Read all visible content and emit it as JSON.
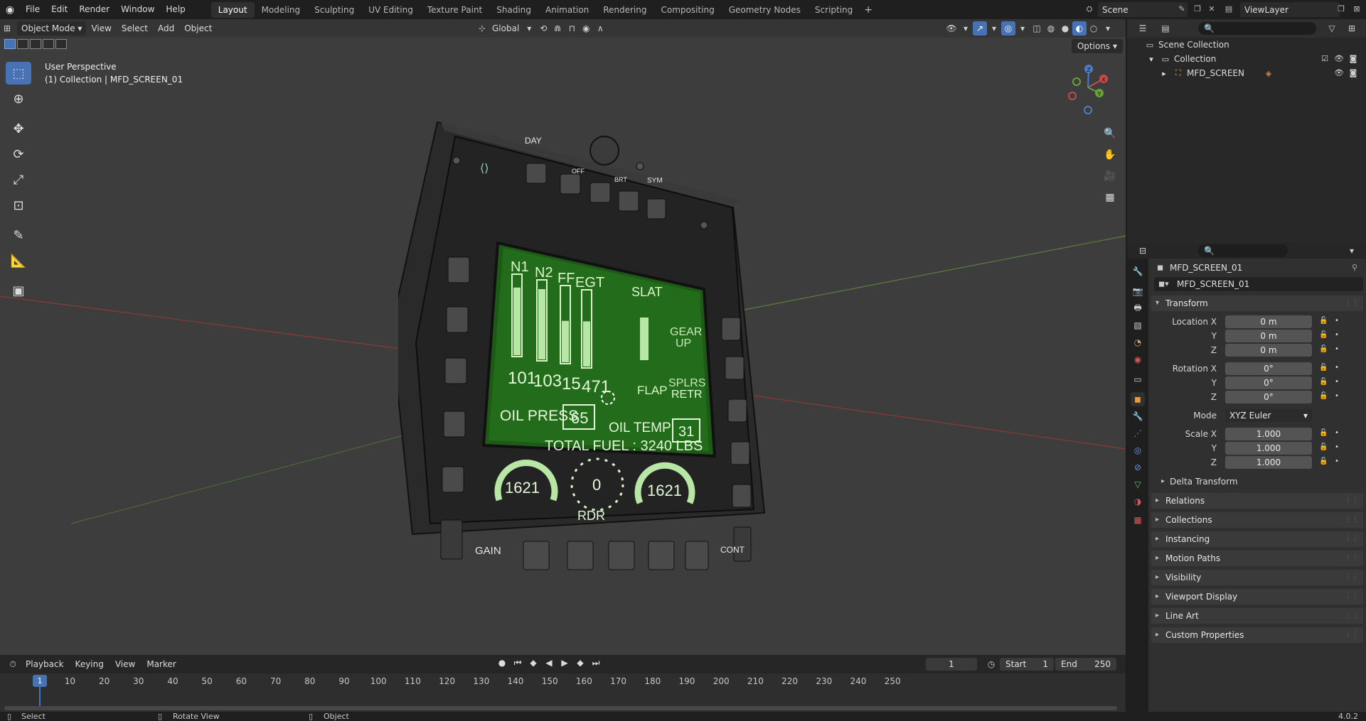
{
  "topbar": {
    "menus": [
      "File",
      "Edit",
      "Render",
      "Window",
      "Help"
    ],
    "workspaces": [
      "Layout",
      "Modeling",
      "Sculpting",
      "UV Editing",
      "Texture Paint",
      "Shading",
      "Animation",
      "Rendering",
      "Compositing",
      "Geometry Nodes",
      "Scripting"
    ],
    "active_workspace": "Layout",
    "scene": "Scene",
    "view_layer": "ViewLayer"
  },
  "viewport": {
    "mode": "Object Mode",
    "menus": [
      "View",
      "Select",
      "Add",
      "Object"
    ],
    "transform_orientation": "Global",
    "options": "Options",
    "perspective_label": "User Perspective",
    "collection_label": "(1) Collection | MFD_SCREEN_01",
    "gizmo": {
      "x": "X",
      "y": "Y",
      "z": "Z"
    }
  },
  "mfd": {
    "top_labels": {
      "day": "DAY",
      "off": "OFF",
      "brt": "BRT",
      "sym": "SYM"
    },
    "engine_labels": [
      "N1",
      "N2",
      "FF",
      "EGT"
    ],
    "engine_values": [
      "101",
      "103",
      "15",
      "471"
    ],
    "engine_levels": [
      0.85,
      0.9,
      0.55,
      0.6
    ],
    "slat": "SLAT",
    "slat_level": 0.75,
    "gear": [
      "GEAR",
      "UP"
    ],
    "flap": "FLAP",
    "splrs": [
      "SPLRS",
      "RETR"
    ],
    "oil_press_label": "OIL PRESS",
    "oil_press_value": "65",
    "oil_temp_label": "OIL TEMP",
    "oil_temp_value": "31",
    "total_fuel": "TOTAL FUEL : 3240 LBS",
    "left_gauge": "1621",
    "center_gauge": "0",
    "right_gauge": "1621",
    "rdr": "RDR",
    "gain": "GAIN",
    "cont": "CONT"
  },
  "timeline": {
    "menus": [
      "Playback",
      "Keying",
      "View",
      "Marker"
    ],
    "current_frame": "1",
    "start_label": "Start",
    "start": "1",
    "end_label": "End",
    "end": "250",
    "ticks": [
      "10",
      "20",
      "30",
      "40",
      "50",
      "60",
      "70",
      "80",
      "90",
      "100",
      "110",
      "120",
      "130",
      "140",
      "150",
      "160",
      "170",
      "180",
      "190",
      "200",
      "210",
      "220",
      "230",
      "240",
      "250"
    ]
  },
  "statusbar": {
    "select": "Select",
    "rotate": "Rotate View",
    "object": "Object",
    "version": "4.0.2"
  },
  "outliner": {
    "scene_collection": "Scene Collection",
    "collection": "Collection",
    "object": "MFD_SCREEN"
  },
  "properties": {
    "object_name": "MFD_SCREEN_01",
    "data_name": "MFD_SCREEN_01",
    "transform": "Transform",
    "location_label": "Location X",
    "rotation_label": "Rotation X",
    "scale_label": "Scale X",
    "y": "Y",
    "z": "Z",
    "loc": [
      "0 m",
      "0 m",
      "0 m"
    ],
    "rot": [
      "0°",
      "0°",
      "0°"
    ],
    "mode_label": "Mode",
    "mode": "XYZ Euler",
    "scale": [
      "1.000",
      "1.000",
      "1.000"
    ],
    "delta": "Delta Transform",
    "panels": [
      "Relations",
      "Collections",
      "Instancing",
      "Motion Paths",
      "Visibility",
      "Viewport Display",
      "Line Art",
      "Custom Properties"
    ]
  }
}
